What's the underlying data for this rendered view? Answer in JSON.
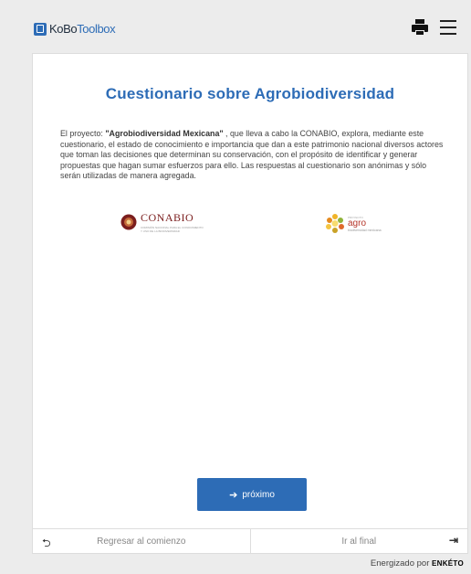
{
  "header": {
    "logo_brand": "KoBo",
    "logo_product": "Toolbox",
    "print_icon": "print-icon",
    "menu_icon": "menu-icon"
  },
  "form": {
    "title": "Cuestionario sobre Agrobiodiversidad",
    "intro_prefix": "El proyecto: ",
    "intro_bold": "\"Agrobiodiversidad Mexicana\"",
    "intro_rest": " , que lleva a cabo la CONABIO, explora, mediante este cuestionario, el estado de conocimiento e importancia que dan a este patrimonio nacional diversos actores que toman las decisiones que determinan su conservación, con el propósito de identificar y generar propuestas que hagan sumar esfuerzos para ello. Las respuestas al cuestionario son anónimas y sólo serán utilizadas de manera agregada.",
    "logo_conabio": "CONABIO",
    "logo_conabio_sub": "COMISIÓN NACIONAL PARA EL CONOCIMIENTO Y USO DE LA BIODIVERSIDAD",
    "logo_agro_pre": "PROYECTO",
    "logo_agro": "agro",
    "logo_agro_sub": "biodiversidad mexicana"
  },
  "nav": {
    "next_label": "próximo",
    "back_label": "Regresar al comienzo",
    "end_label": "Ir al final"
  },
  "footer": {
    "powered_prefix": "Energizado por ",
    "powered_brand": "ENKÉTO"
  },
  "colors": {
    "accent": "#2d6cb6",
    "background": "#ececec",
    "conabio": "#7b1e1e",
    "agro": "#b5362a"
  }
}
